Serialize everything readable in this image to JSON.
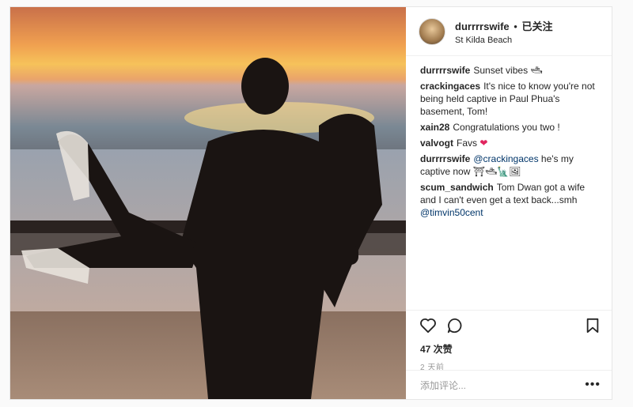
{
  "header": {
    "username": "durrrrswife",
    "separator": "•",
    "follow_status": "已关注",
    "location": "St Kilda Beach"
  },
  "caption": {
    "username": "durrrrswife",
    "text": "Sunset vibes 🛥"
  },
  "comments": [
    {
      "username": "crackingaces",
      "text": "It's nice to know you're not being held captive in Paul Phua's basement, Tom!"
    },
    {
      "username": "xain28",
      "text": "Congratulations you two !"
    },
    {
      "username": "valvogt",
      "text": "Favs",
      "emoji": "❤"
    },
    {
      "username": "durrrrswife",
      "mention": "@crackingaces",
      "text": " he's my captive now ⛩🛥🗽🖼"
    },
    {
      "username": "scum_sandwich",
      "text": "Tom Dwan got a wife and I can't even get a text back...smh",
      "mention": "@timvin50cent"
    }
  ],
  "engagement": {
    "likes": "47 次赞",
    "time": "2 天前"
  },
  "add_comment": {
    "placeholder": "添加评论...",
    "more": "•••"
  },
  "icons": {
    "like": "heart-icon",
    "comment": "comment-icon",
    "save": "bookmark-icon"
  }
}
